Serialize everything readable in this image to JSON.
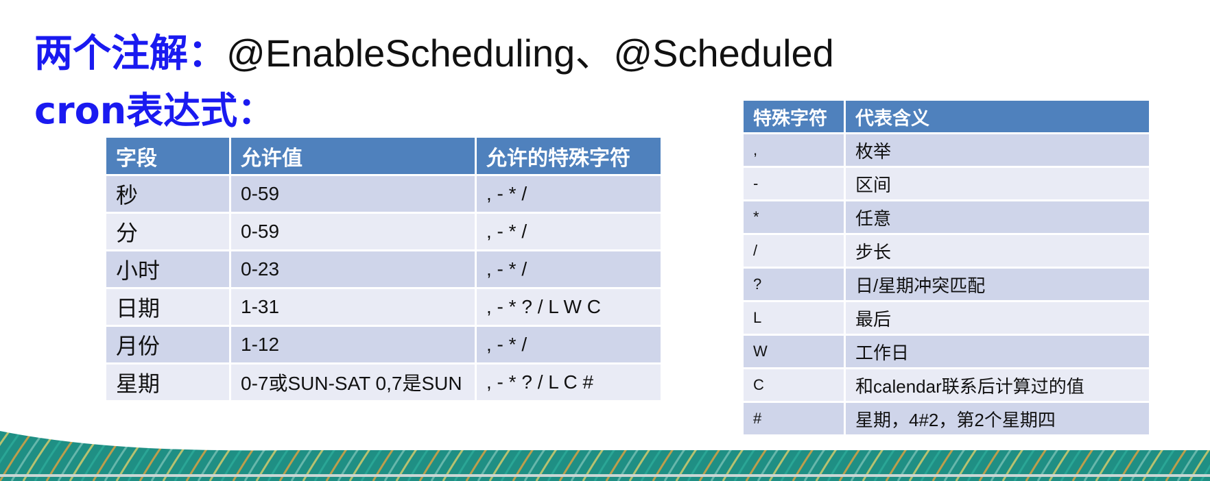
{
  "headings": {
    "annotations_label": "两个注解：",
    "annotations_value": "@EnableScheduling、@Scheduled",
    "cron_label": "cron表达式："
  },
  "fields_table": {
    "headers": [
      "字段",
      "允许值",
      "允许的特殊字符"
    ],
    "rows": [
      [
        "秒",
        "0-59",
        ", - * /"
      ],
      [
        "分",
        "0-59",
        ", - * /"
      ],
      [
        "小时",
        "0-23",
        ", - * /"
      ],
      [
        "日期",
        "1-31",
        ", - * ? / L W C"
      ],
      [
        "月份",
        "1-12",
        ", - * /"
      ],
      [
        "星期",
        "0-7或SUN-SAT 0,7是SUN",
        ", - * ? / L C #"
      ]
    ]
  },
  "special_chars_table": {
    "headers": [
      "特殊字符",
      "代表含义"
    ],
    "rows": [
      [
        ",",
        "枚举"
      ],
      [
        "-",
        "区间"
      ],
      [
        "*",
        "任意"
      ],
      [
        "/",
        "步长"
      ],
      [
        "?",
        "日/星期冲突匹配"
      ],
      [
        "L",
        "最后"
      ],
      [
        "W",
        "工作日"
      ],
      [
        "C",
        "和calendar联系后计算过的值"
      ],
      [
        "#",
        "星期，4#2，第2个星期四"
      ]
    ]
  },
  "colors": {
    "heading_blue": "#1a1af0",
    "table_header": "#4f81bd",
    "row_dark": "#cfd5ea",
    "row_light": "#e9ebf5",
    "footer_teal": "#1f8f84",
    "footer_orange": "#f2a33a"
  }
}
